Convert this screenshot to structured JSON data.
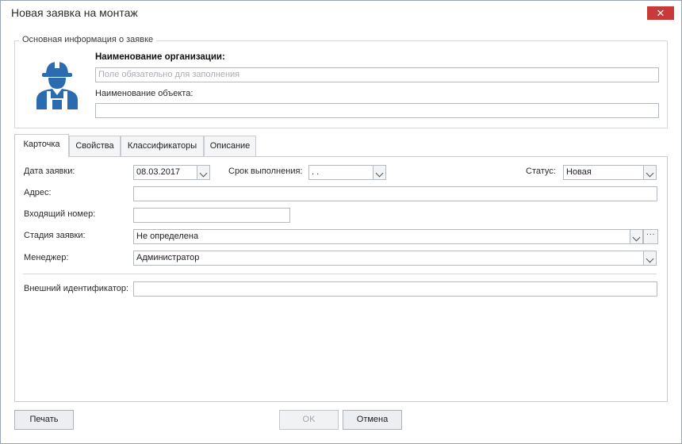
{
  "window": {
    "title": "Новая заявка на монтаж",
    "close_glyph": "✕"
  },
  "group": {
    "legend": "Основная информация о заявке",
    "icon": "worker-icon",
    "org_label": "Наименование организации:",
    "org_placeholder": "Поле обязательно для заполнения",
    "object_label": "Наименование объекта:",
    "object_value": ""
  },
  "tabs": [
    "Карточка",
    "Свойства",
    "Классификаторы",
    "Описание"
  ],
  "form": {
    "date_label": "Дата заявки:",
    "date_value": "08.03.2017",
    "deadline_label": "Срок выполнения:",
    "deadline_value": ". .",
    "status_label": "Статус:",
    "status_value": "Новая",
    "address_label": "Адрес:",
    "address_value": "",
    "incoming_label": "Входящий номер:",
    "incoming_value": "",
    "stage_label": "Стадия заявки:",
    "stage_value": "Не определена",
    "manager_label": "Менеджер:",
    "manager_value": "Администратор",
    "external_label": "Внешний идентификатор:",
    "external_value": ""
  },
  "buttons": {
    "print": "Печать",
    "ok": "OK",
    "cancel": "Отмена"
  },
  "colors": {
    "close_button": "#c8393a",
    "worker_icon": "#2b6cb0"
  }
}
